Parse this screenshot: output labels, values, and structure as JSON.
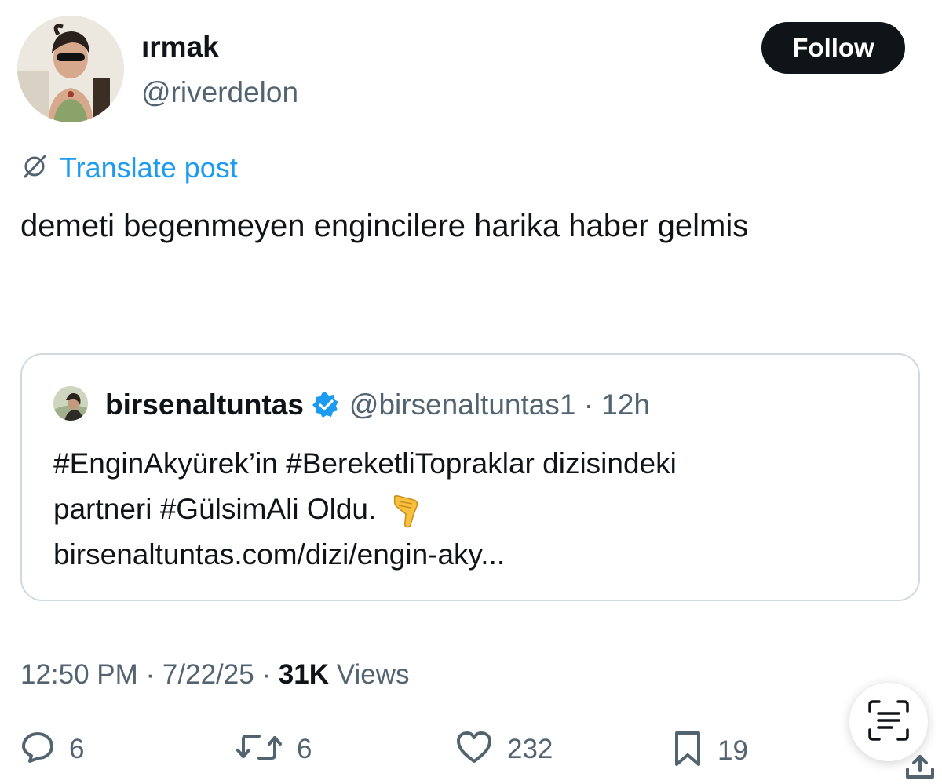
{
  "author": {
    "display_name": "ırmak",
    "handle": "@riverdelon"
  },
  "follow_button": {
    "label": "Follow"
  },
  "translate": {
    "label": "Translate post"
  },
  "post": {
    "text": "demeti begenmeyen engincilere harika haber gelmis"
  },
  "quoted_post": {
    "display_name": "birsenaltuntas",
    "handle_time": "@birsenaltuntas1 · 12h",
    "lines": [
      "#EnginAkyürek’in #BereketliTopraklar dizisindeki",
      "partneri #GülsimAli Oldu.",
      "birsenaltuntas.com/dizi/engin-aky..."
    ],
    "emoji": "pointing-down-hand"
  },
  "meta": {
    "time_date": "12:50 PM · 7/22/25 · ",
    "views_count": "31K",
    "views_label": " Views"
  },
  "actions": {
    "replies": "6",
    "reposts": "6",
    "likes": "232",
    "bookmarks": "19"
  },
  "colors": {
    "accent": "#1d9bf0",
    "text": "#0f1419",
    "secondary": "#536471",
    "border": "#cfd9de"
  },
  "icons": [
    "translate-icon",
    "verified-badge-icon",
    "reply-icon",
    "repost-icon",
    "like-icon",
    "bookmark-icon",
    "text-scan-icon",
    "share-icon"
  ]
}
